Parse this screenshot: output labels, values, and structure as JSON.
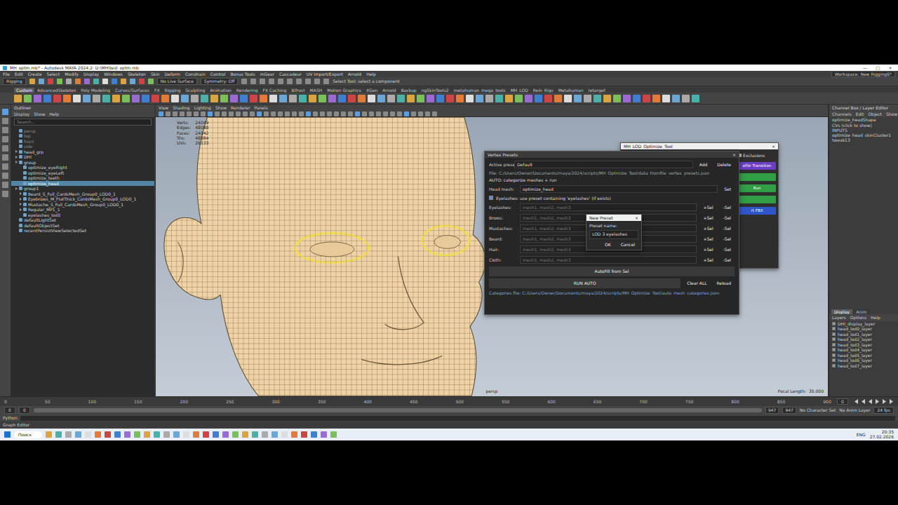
{
  "window": {
    "title": "MH_optm.mb* - Autodesk MAYA 2024.2: D:\\MH\\test_optm.mb",
    "controls": [
      "—",
      "□",
      "×"
    ]
  },
  "menu": [
    "File",
    "Edit",
    "Create",
    "Select",
    "Modify",
    "Display",
    "Windows",
    "Skeleton",
    "Skin",
    "Deform",
    "Constrain",
    "Control",
    "Bonus Tools",
    "mGear",
    "Cascadeur",
    "UV Import/Export",
    "Arnold",
    "Help"
  ],
  "workspace": "Workspace: New Rigging6*",
  "status_line": {
    "mode": "Rigging",
    "live_surface": "No Live Surface",
    "symmetry": "Symmetry: Off",
    "hint": "Select Tool: select a component"
  },
  "shelf_tabs": [
    {
      "label": "Custom",
      "selected": true
    },
    {
      "label": "AdvancedSkeleton",
      "selected": false
    },
    {
      "label": "Poly Modeling",
      "selected": false
    },
    {
      "label": "Curves/Surfaces",
      "selected": false
    },
    {
      "label": "FX",
      "selected": false
    },
    {
      "label": "Rigging",
      "selected": false
    },
    {
      "label": "Sculpting",
      "selected": false
    },
    {
      "label": "Animation",
      "selected": false
    },
    {
      "label": "Rendering",
      "selected": false
    },
    {
      "label": "FX Caching",
      "selected": false
    },
    {
      "label": "Bifrost",
      "selected": false
    },
    {
      "label": "MASH",
      "selected": false
    },
    {
      "label": "Motion Graphics",
      "selected": false
    },
    {
      "label": "XGen",
      "selected": false
    },
    {
      "label": "Arnold",
      "selected": false
    },
    {
      "label": "Backup",
      "selected": false
    },
    {
      "label": "ngSkinTools2",
      "selected": false
    },
    {
      "label": "metahuman_mega_tools",
      "selected": false
    },
    {
      "label": "MH_LOD",
      "selected": false
    },
    {
      "label": "Rein_Rigs",
      "selected": false
    },
    {
      "label": "Metahuman",
      "selected": false
    },
    {
      "label": "retarget",
      "selected": false
    }
  ],
  "outliner": {
    "title": "Outliner",
    "menu": [
      "Display",
      "Show",
      "Help"
    ],
    "search": "Search...",
    "items": [
      {
        "label": "persp",
        "depth": 0,
        "dim": true,
        "selected": false,
        "expandable": false
      },
      {
        "label": "top",
        "depth": 0,
        "dim": true,
        "selected": false,
        "expandable": false
      },
      {
        "label": "front",
        "depth": 0,
        "dim": true,
        "selected": false,
        "expandable": false
      },
      {
        "label": "side",
        "depth": 0,
        "dim": true,
        "selected": false,
        "expandable": false
      },
      {
        "label": "head_grp",
        "depth": 0,
        "dim": false,
        "selected": false,
        "expandable": true
      },
      {
        "label": "DHI",
        "depth": 0,
        "dim": false,
        "selected": false,
        "expandable": true
      },
      {
        "label": "group",
        "depth": 0,
        "dim": false,
        "selected": false,
        "expandable": true
      },
      {
        "label": "optimize_eyeRight",
        "depth": 1,
        "dim": false,
        "selected": false,
        "expandable": false
      },
      {
        "label": "optimize_eyeLeft",
        "depth": 1,
        "dim": false,
        "selected": false,
        "expandable": false
      },
      {
        "label": "optimize_teeth",
        "depth": 1,
        "dim": false,
        "selected": false,
        "expandable": false
      },
      {
        "label": "optimize_head",
        "depth": 1,
        "dim": false,
        "selected": true,
        "expandable": false
      },
      {
        "label": "group1",
        "depth": 0,
        "dim": false,
        "selected": false,
        "expandable": true
      },
      {
        "label": "Beard_S_Full_CardsMesh_Group0_LOD0_1",
        "depth": 1,
        "dim": false,
        "selected": false,
        "expandable": true
      },
      {
        "label": "Eyebrows_M_FlatThick_CardsMesh_Group0_LOD0_1",
        "depth": 1,
        "dim": false,
        "selected": false,
        "expandable": true
      },
      {
        "label": "Mustache_S_Full_CardsMesh_Group0_LOD0_1",
        "depth": 1,
        "dim": false,
        "selected": false,
        "expandable": true
      },
      {
        "label": "Regular_MP1_1",
        "depth": 1,
        "dim": false,
        "selected": false,
        "expandable": true
      },
      {
        "label": "eyelashes_lod0",
        "depth": 1,
        "dim": false,
        "selected": false,
        "expandable": false
      },
      {
        "label": "defaultLightSet",
        "depth": 0,
        "dim": false,
        "selected": false,
        "expandable": false
      },
      {
        "label": "defaultObjectSet",
        "depth": 0,
        "dim": false,
        "selected": false,
        "expandable": false
      },
      {
        "label": "recentPersistViewSelectedSet",
        "depth": 0,
        "dim": false,
        "selected": false,
        "expandable": false
      }
    ]
  },
  "viewport": {
    "menu": [
      "View",
      "Shading",
      "Lighting",
      "Show",
      "Renderer",
      "Panels"
    ],
    "hud": [
      {
        "label": "Verts:",
        "value": "24049"
      },
      {
        "label": "Edges:",
        "value": "48088"
      },
      {
        "label": "Faces:",
        "value": "24042"
      },
      {
        "label": "Tris:",
        "value": "48084"
      },
      {
        "label": "UVs:",
        "value": "26133"
      }
    ],
    "camera": "persp",
    "focal": [
      {
        "label": "Focal Length:",
        "value": "35.000"
      }
    ]
  },
  "vertex_presets": {
    "title": "Vertex Presets",
    "close": "×",
    "active_label": "Active preset:",
    "active_value": "Default",
    "add": "Add",
    "delete": "Delete",
    "file": "File: C:/Users/Owner/Documents/maya/2024/scripts/MH_Optimize_Tool/data_fromfile_vertex_presets.json",
    "auto_title": "AUTO: categorize meshes + run",
    "head_label": "Head mesh:",
    "head_value": "optimize_head",
    "head_button": "Set",
    "note": "Eyelashes: use preset containing 'eyelashes' (if exists)",
    "note_checked": true,
    "categories": [
      {
        "label": "Eyelashes:",
        "placeholder": "mesh1, mesh2, mesh3"
      },
      {
        "label": "Brows:",
        "placeholder": "mesh1, mesh2, mesh3"
      },
      {
        "label": "Mustaches:",
        "placeholder": "mesh1, mesh2, mesh3"
      },
      {
        "label": "Beard:",
        "placeholder": "mesh1, mesh2, mesh3"
      },
      {
        "label": "Hair:",
        "placeholder": "mesh1, mesh2, mesh3"
      },
      {
        "label": "Cloth:",
        "placeholder": "mesh1, mesh2, mesh3"
      }
    ],
    "add_sel": "+Sel",
    "remove_sel": "-Sel",
    "autofill": "AutoFill from Sel",
    "run": "RUN AUTO",
    "clear": "Clear ALL",
    "reload": "Reload",
    "footer": "Categories file: C:/Users/Owner/Documents/maya/2024/scripts/MH_Optimize_Tool/auto_mesh_categories.json"
  },
  "mh_tool": {
    "title": "MH_LOD_Optimize_Tool",
    "close": "×",
    "exclusions": "Exclusions",
    "buttons": [
      {
        "label": "ofile Transition",
        "color": "#6a3fc4"
      },
      {
        "color": "#2f9e44"
      },
      {
        "label": "Run",
        "color": "#2f9e44"
      },
      {
        "color": "#2f9e44"
      },
      {
        "label": "rt FBX",
        "color": "#2f55c8"
      }
    ]
  },
  "new_preset": {
    "title": "New Preset",
    "close": "×",
    "label": "Preset name:",
    "value": "LOD 3 eyelashes",
    "ok": "OK",
    "cancel": "Cancel"
  },
  "channel_box": {
    "title": "Channel Box / Layer Editor",
    "menu": [
      "Channels",
      "Edit",
      "Object",
      "Show"
    ],
    "lines": [
      "optimize_headShape",
      "CVs (click to show)",
      "INPUTS",
      "optimize_head_skinCluster1",
      "tweak13"
    ],
    "layer_tabs": [
      {
        "label": "Display",
        "selected": true
      },
      {
        "label": "Anim",
        "selected": false
      }
    ],
    "layer_menu": [
      "Layers",
      "Options",
      "Help"
    ],
    "layers": [
      {
        "label": "DHI_display_layer",
        "visible": true
      },
      {
        "label": "head_lod0_layer",
        "visible": true
      },
      {
        "label": "head_lod1_layer",
        "visible": true
      },
      {
        "label": "head_lod2_layer",
        "visible": true
      },
      {
        "label": "head_lod3_layer",
        "visible": true
      },
      {
        "label": "head_lod4_layer",
        "visible": true
      },
      {
        "label": "head_lod5_layer",
        "visible": true
      },
      {
        "label": "head_lod6_layer",
        "visible": true
      },
      {
        "label": "head_lod7_layer",
        "visible": true
      }
    ]
  },
  "timeline": {
    "ticks": [
      "0",
      "50",
      "100",
      "150",
      "200",
      "250",
      "300",
      "350",
      "400",
      "450",
      "500",
      "550",
      "600",
      "650",
      "700",
      "750",
      "800",
      "850",
      "900"
    ],
    "current": "0"
  },
  "range": {
    "start": "0",
    "inner_start": "0",
    "inner_end": "947",
    "end": "947",
    "character": "No Character Set",
    "anim_layer": "No Anim Layer",
    "fps": "24 fps"
  },
  "command_line": {
    "language": "Python"
  },
  "help_line": {
    "text": "Graph Editor"
  },
  "taskbar": {
    "search": "Поиск",
    "language": "ENG",
    "time": "20:35",
    "date": "27.02.2026"
  }
}
